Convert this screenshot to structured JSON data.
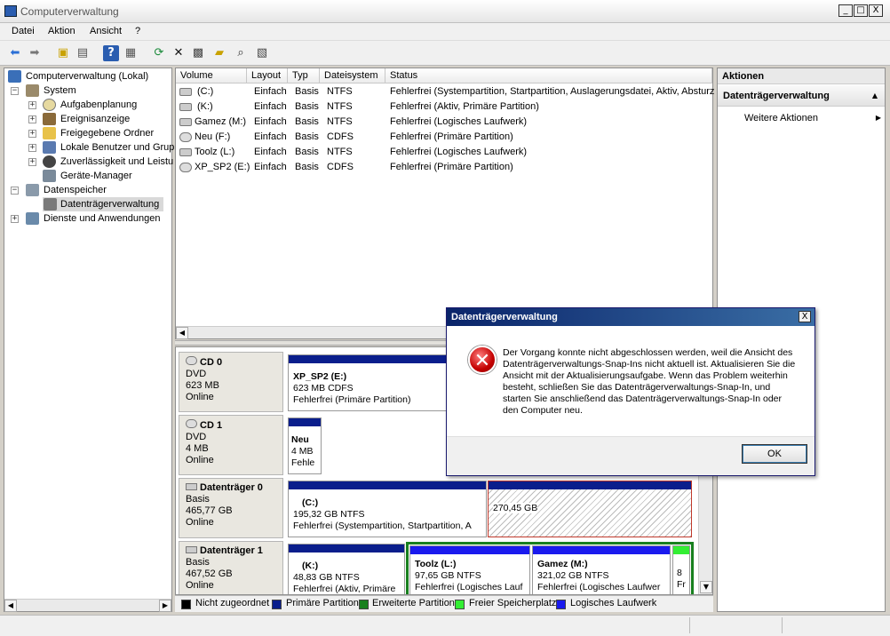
{
  "window": {
    "title": "Computerverwaltung",
    "minimize": "_",
    "maximize": "□",
    "close": "X"
  },
  "menu": [
    "Datei",
    "Aktion",
    "Ansicht",
    "?"
  ],
  "toolbar_icons": [
    "back-arrow-icon",
    "forward-arrow-icon",
    "up-folder-icon",
    "show-hide-tree-icon",
    "help-icon",
    "console-icon",
    "refresh-icon",
    "delete-icon",
    "properties-icon",
    "open-icon",
    "search-icon",
    "export-icon"
  ],
  "tree": {
    "root": "Computerverwaltung (Lokal)",
    "items": [
      {
        "label": "System",
        "level": 1,
        "expander": "−"
      },
      {
        "label": "Aufgabenplanung",
        "level": 2,
        "expander": "+"
      },
      {
        "label": "Ereignisanzeige",
        "level": 2,
        "expander": "+"
      },
      {
        "label": "Freigegebene Ordner",
        "level": 2,
        "expander": "+"
      },
      {
        "label": "Lokale Benutzer und Grupp",
        "level": 2,
        "expander": "+"
      },
      {
        "label": "Zuverlässigkeit und Leistu",
        "level": 2,
        "expander": "+"
      },
      {
        "label": "Geräte-Manager",
        "level": 2,
        "expander": ""
      },
      {
        "label": "Datenspeicher",
        "level": 1,
        "expander": "−"
      },
      {
        "label": "Datenträgerverwaltung",
        "level": 2,
        "expander": "",
        "selected": true
      },
      {
        "label": "Dienste und Anwendungen",
        "level": 1,
        "expander": "+"
      }
    ]
  },
  "volumes": {
    "headers": [
      "Volume",
      "Layout",
      "Typ",
      "Dateisystem",
      "Status"
    ],
    "rows": [
      [
        "(C:)",
        "Einfach",
        "Basis",
        "NTFS",
        "Fehlerfrei (Systempartition, Startpartition, Auslagerungsdatei, Aktiv, Absturz"
      ],
      [
        "(K:)",
        "Einfach",
        "Basis",
        "NTFS",
        "Fehlerfrei (Aktiv, Primäre Partition)"
      ],
      [
        "Gamez (M:)",
        "Einfach",
        "Basis",
        "NTFS",
        "Fehlerfrei (Logisches Laufwerk)"
      ],
      [
        "Neu (F:)",
        "Einfach",
        "Basis",
        "CDFS",
        "Fehlerfrei (Primäre Partition)"
      ],
      [
        "Toolz (L:)",
        "Einfach",
        "Basis",
        "NTFS",
        "Fehlerfrei (Logisches Laufwerk)"
      ],
      [
        "XP_SP2 (E:)",
        "Einfach",
        "Basis",
        "CDFS",
        "Fehlerfrei (Primäre Partition)"
      ]
    ]
  },
  "disks": [
    {
      "name": "CD 0",
      "type": "DVD",
      "size": "623 MB",
      "state": "Online",
      "partitions": [
        {
          "title": "XP_SP2  (E:)",
          "size": "623 MB CDFS",
          "status": "Fehlerfrei (Primäre Partition)"
        }
      ]
    },
    {
      "name": "CD 1",
      "type": "DVD",
      "size": "4 MB",
      "state": "Online",
      "partitions": [
        {
          "title": "Neu",
          "size": "4 MB",
          "status": "Fehle"
        }
      ]
    },
    {
      "name": "Datenträger 0",
      "type": "Basis",
      "size": "465,77 GB",
      "state": "Online",
      "partitions": [
        {
          "title": "(C:)",
          "size": "195,32 GB NTFS",
          "status": "Fehlerfrei (Systempartition, Startpartition, A"
        },
        {
          "title": "",
          "size": "270,45 GB",
          "status": ""
        }
      ]
    },
    {
      "name": "Datenträger 1",
      "type": "Basis",
      "size": "467,52 GB",
      "state": "Online",
      "partitions": [
        {
          "title": "(K:)",
          "size": "48,83 GB NTFS",
          "status": "Fehlerfrei (Aktiv, Primäre"
        },
        {
          "title": "Toolz  (L:)",
          "size": "97,65 GB NTFS",
          "status": "Fehlerfrei (Logisches Lauf"
        },
        {
          "title": "Gamez  (M:)",
          "size": "321,02 GB NTFS",
          "status": "Fehlerfrei (Logisches Laufwer"
        },
        {
          "title": "",
          "size": "8",
          "status": "Fr"
        }
      ]
    }
  ],
  "legend": [
    {
      "label": "Nicht zugeordnet",
      "color": "#000000"
    },
    {
      "label": "Primäre Partition",
      "color": "#0a1e8c"
    },
    {
      "label": "Erweiterte Partition",
      "color": "#18801e"
    },
    {
      "label": "Freier Speicherplatz",
      "color": "#33ee33"
    },
    {
      "label": "Logisches Laufwerk",
      "color": "#1a1aee"
    }
  ],
  "actions": {
    "header": "Aktionen",
    "section": "Datenträgerverwaltung",
    "item": "Weitere Aktionen"
  },
  "dialog": {
    "title": "Datenträgerverwaltung",
    "close": "X",
    "message": "Der Vorgang konnte nicht abgeschlossen werden, weil die Ansicht des Datenträgerverwaltungs-Snap-Ins nicht aktuell ist. Aktualisieren Sie die Ansicht mit der Aktualisierungsaufgabe. Wenn das Problem weiterhin besteht, schließen Sie das Datenträgerverwaltungs-Snap-In, und starten Sie anschließend das Datenträgerverwaltungs-Snap-In oder den Computer neu.",
    "ok": "OK",
    "icon": "error-icon"
  },
  "colors": {
    "primary": "#0a1e8c",
    "logical": "#1a1aee",
    "extended": "#18801e",
    "free": "#33ee33",
    "title_blue": "#0a246a"
  }
}
